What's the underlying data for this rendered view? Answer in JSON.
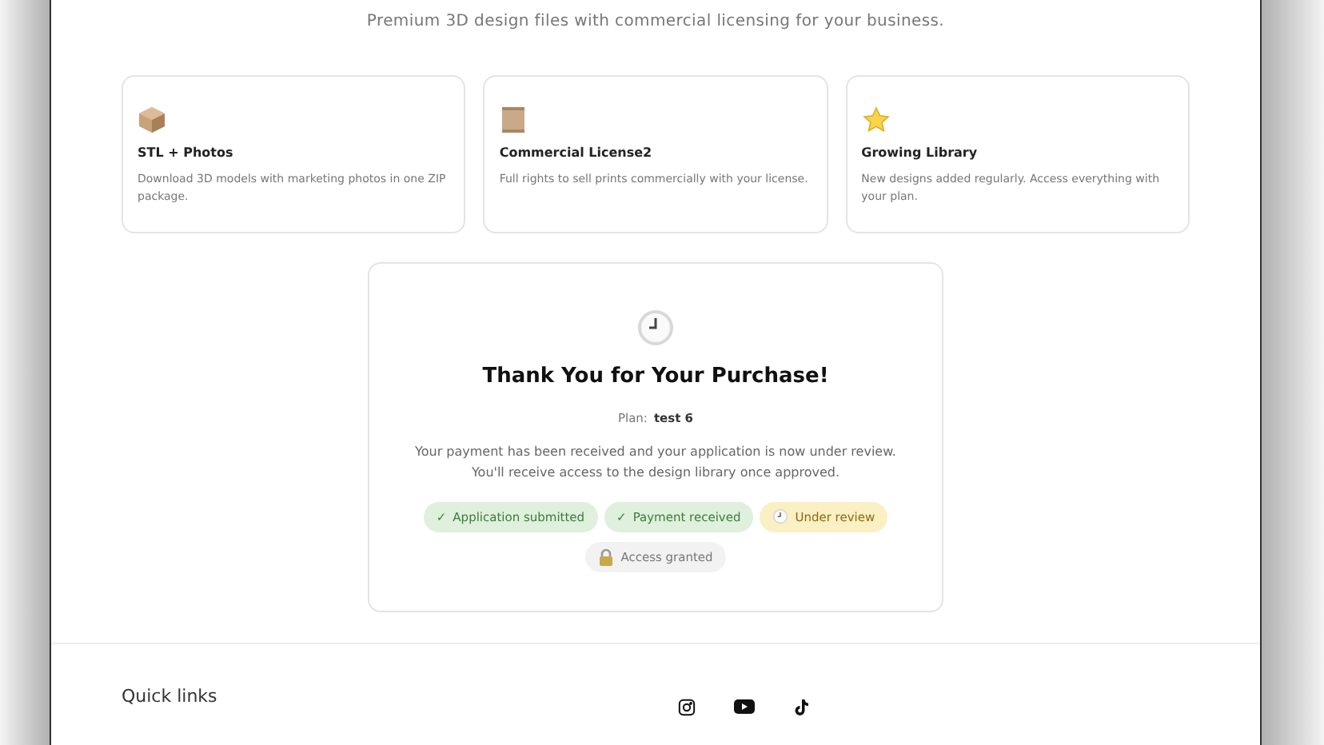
{
  "subtitle": "Premium 3D design files with commercial licensing for your business.",
  "features": [
    {
      "title": "STL + Photos",
      "description": "Download 3D models with marketing photos in one ZIP package."
    },
    {
      "title": "Commercial License2",
      "description": "Full rights to sell prints commercially with your license."
    },
    {
      "title": "Growing Library",
      "description": "New designs added regularly. Access everything with your plan."
    }
  ],
  "confirmation": {
    "title": "Thank You for Your Purchase!",
    "plan_label": "Plan:",
    "plan_name": "test 6",
    "message": "Your payment has been received and your application is now under review. You'll receive access to the design library once approved.",
    "steps": [
      {
        "kind": "done",
        "mark": "✓",
        "label": "Application submitted"
      },
      {
        "kind": "done",
        "mark": "✓",
        "label": "Payment received"
      },
      {
        "kind": "current",
        "label": "Under review"
      },
      {
        "kind": "pending",
        "label": "Access granted"
      }
    ]
  },
  "footer": {
    "heading": "Quick links"
  }
}
